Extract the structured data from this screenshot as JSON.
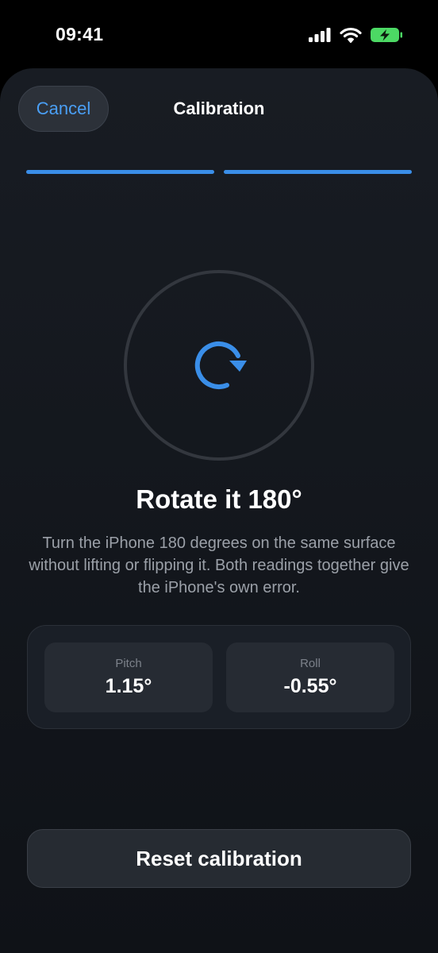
{
  "status_bar": {
    "time": "09:41",
    "icons": [
      "signal-icon",
      "wifi-icon",
      "battery-charging-icon"
    ],
    "battery_color": "#4cd964"
  },
  "nav": {
    "cancel_label": "Cancel",
    "title": "Calibration"
  },
  "progress": {
    "steps_total": 2,
    "steps_done": 2,
    "color": "#3a8ee8"
  },
  "step": {
    "icon": "rotate-clockwise-icon",
    "heading": "Rotate it 180°",
    "description": "Turn the iPhone 180 degrees on the same surface without lifting or flipping it. Both readings together give the iPhone's own error."
  },
  "readings": {
    "pitch": {
      "label": "Pitch",
      "value": "1.15°"
    },
    "roll": {
      "label": "Roll",
      "value": "-0.55°"
    }
  },
  "actions": {
    "reset_label": "Reset calibration"
  },
  "colors": {
    "accent": "#4a9ff5",
    "background": "#14181e"
  }
}
